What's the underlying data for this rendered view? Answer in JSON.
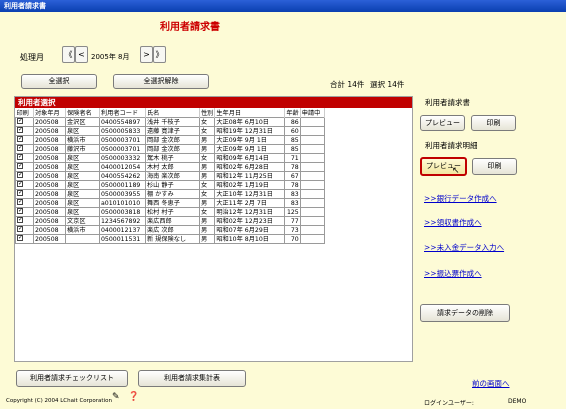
{
  "window": {
    "title": "利用者請求書"
  },
  "page_title": "利用者請求書",
  "month": {
    "label": "処理月",
    "value": "2005年 8月",
    "first": "《",
    "prev": "<",
    "next": ">",
    "last": "》"
  },
  "buttons": {
    "select_all": "全選択",
    "deselect_all": "全選択解除",
    "check_list": "利用者請求チェックリスト",
    "summary": "利用者請求集計表",
    "delete": "請求データの削除"
  },
  "totals": {
    "total": "合計 14件",
    "selected": "選択 14件"
  },
  "list": {
    "title": "利用者選択",
    "columns": [
      "印刷",
      "対象年月",
      "保険者名",
      "利用者コード",
      "氏名",
      "性別",
      "生年月日",
      "年齢",
      "申請中"
    ],
    "rows": [
      {
        "ym": "200508",
        "ins": "金沢区",
        "code": "0400554897",
        "name": "浅井 千枝子",
        "sex": "女",
        "dob": "大正08年 6月10日",
        "age": "86",
        "app": ""
      },
      {
        "ym": "200508",
        "ins": "泉区",
        "code": "0500005833",
        "name": "遠藤 寛津子",
        "sex": "女",
        "dob": "昭和19年 12月31日",
        "age": "60",
        "app": ""
      },
      {
        "ym": "200508",
        "ins": "横浜市",
        "code": "0500003701",
        "name": "岡部 金次郎",
        "sex": "男",
        "dob": "大正09年 9月 1日",
        "age": "85",
        "app": ""
      },
      {
        "ym": "200508",
        "ins": "藤沢市",
        "code": "0500003701",
        "name": "岡部 金次郎",
        "sex": "男",
        "dob": "大正09年 9月 1日",
        "age": "85",
        "app": ""
      },
      {
        "ym": "200508",
        "ins": "泉区",
        "code": "0500003332",
        "name": "駕木 桃子",
        "sex": "女",
        "dob": "昭和09年 6月14日",
        "age": "71",
        "app": ""
      },
      {
        "ym": "200508",
        "ins": "泉区",
        "code": "0400012054",
        "name": "木村 太郎",
        "sex": "男",
        "dob": "昭和02年 6月28日",
        "age": "78",
        "app": ""
      },
      {
        "ym": "200508",
        "ins": "泉区",
        "code": "0400554262",
        "name": "海南 楽次郎",
        "sex": "男",
        "dob": "昭和12年 11月25日",
        "age": "67",
        "app": ""
      },
      {
        "ym": "200508",
        "ins": "泉区",
        "code": "0500001189",
        "name": "杉山 静子",
        "sex": "女",
        "dob": "昭和02年 1月19日",
        "age": "78",
        "app": ""
      },
      {
        "ym": "200508",
        "ins": "泉区",
        "code": "0500003955",
        "name": "棚 かすみ",
        "sex": "女",
        "dob": "大正10年 12月31日",
        "age": "83",
        "app": ""
      },
      {
        "ym": "200508",
        "ins": "泉区",
        "code": "a010101010",
        "name": "舞西 冬恵子",
        "sex": "男",
        "dob": "大正11年 2月 7日",
        "age": "83",
        "app": ""
      },
      {
        "ym": "200508",
        "ins": "泉区",
        "code": "0500003818",
        "name": "松村 村子",
        "sex": "女",
        "dob": "明治12年 12月31日",
        "age": "125",
        "app": ""
      },
      {
        "ym": "200508",
        "ins": "文京区",
        "code": "1234567892",
        "name": "楽広西郎",
        "sex": "男",
        "dob": "昭和02年 12月23日",
        "age": "77",
        "app": ""
      },
      {
        "ym": "200508",
        "ins": "横浜市",
        "code": "0400012137",
        "name": "楽広 次郎",
        "sex": "男",
        "dob": "昭和07年 6月29日",
        "age": "73",
        "app": ""
      },
      {
        "ym": "200508",
        "ins": "",
        "code": "0500011531",
        "name": "新 規保険なし",
        "sex": "男",
        "dob": "昭和10年 8月10日",
        "age": "70",
        "app": ""
      }
    ]
  },
  "right": {
    "invoice_label": "利用者請求書",
    "detail_label": "利用者請求明細",
    "preview": "プレビュー",
    "print": "印刷",
    "links": {
      "bank": ">>銀行データ作成へ",
      "receipt": ">>領収書作成へ",
      "unpaid": ">>未入金データ入力へ",
      "transfer": ">>振込票作成へ"
    },
    "back": "前の画面へ"
  },
  "footer": {
    "copyright": "Copyright (C) 2004 LChait Corporation",
    "login_label": "ログインユーザー:",
    "user": "DEMO"
  }
}
